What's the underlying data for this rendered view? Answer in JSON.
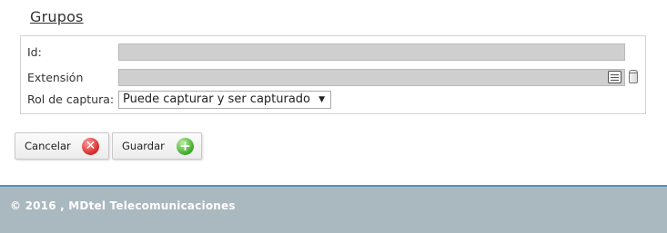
{
  "page": {
    "title": "Grupos"
  },
  "form": {
    "id_label": "Id:",
    "id_value": "",
    "extension_label": "Extensión",
    "extension_value": "",
    "rol_label": "Rol de captura:",
    "rol_selected": "Puede capturar y ser capturado",
    "rol_arrow": "▼"
  },
  "icons": {
    "list": "list-icon",
    "trash": "trash-icon",
    "cancel": "cancel-icon",
    "add": "add-icon"
  },
  "buttons": {
    "cancel_label": "Cancelar",
    "cancel_glyph": "✕",
    "save_label": "Guardar",
    "save_glyph": "+"
  },
  "footer": {
    "text": "© 2016 , MDtel Telecomunicaciones"
  },
  "colors": {
    "footer_bg": "#aab8c0",
    "footer_line": "#5a8fc0",
    "cancel_icon": "#d42a2a",
    "save_icon": "#3fa82b"
  }
}
